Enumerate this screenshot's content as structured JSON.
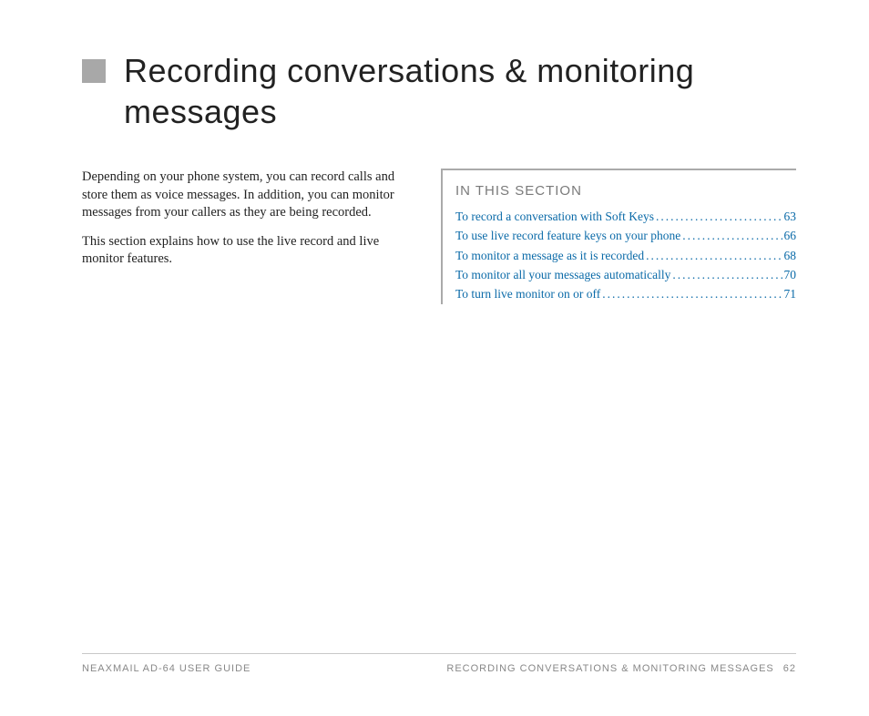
{
  "title": "Recording conversations & monitoring messages",
  "body": {
    "p1": "Depending on your phone system, you can record calls and store them as voice messages. In addition, you can monitor messages from your callers as they are being recorded.",
    "p2": "This section explains how to use the live record and live monitor features."
  },
  "section": {
    "heading": "IN THIS SECTION",
    "items": [
      {
        "label": "To record a conversation with Soft Keys",
        "page": "63"
      },
      {
        "label": "To use live record feature keys on your phone",
        "page": "66"
      },
      {
        "label": "To monitor a message as it is recorded",
        "page": "68"
      },
      {
        "label": "To monitor all your messages automatically",
        "page": "70"
      },
      {
        "label": "To turn live monitor on or off",
        "page": "71"
      }
    ]
  },
  "footer": {
    "left": "NEAXMAIL AD-64 USER GUIDE",
    "right_title": "RECORDING CONVERSATIONS & MONITORING MESSAGES",
    "right_page": "62"
  }
}
